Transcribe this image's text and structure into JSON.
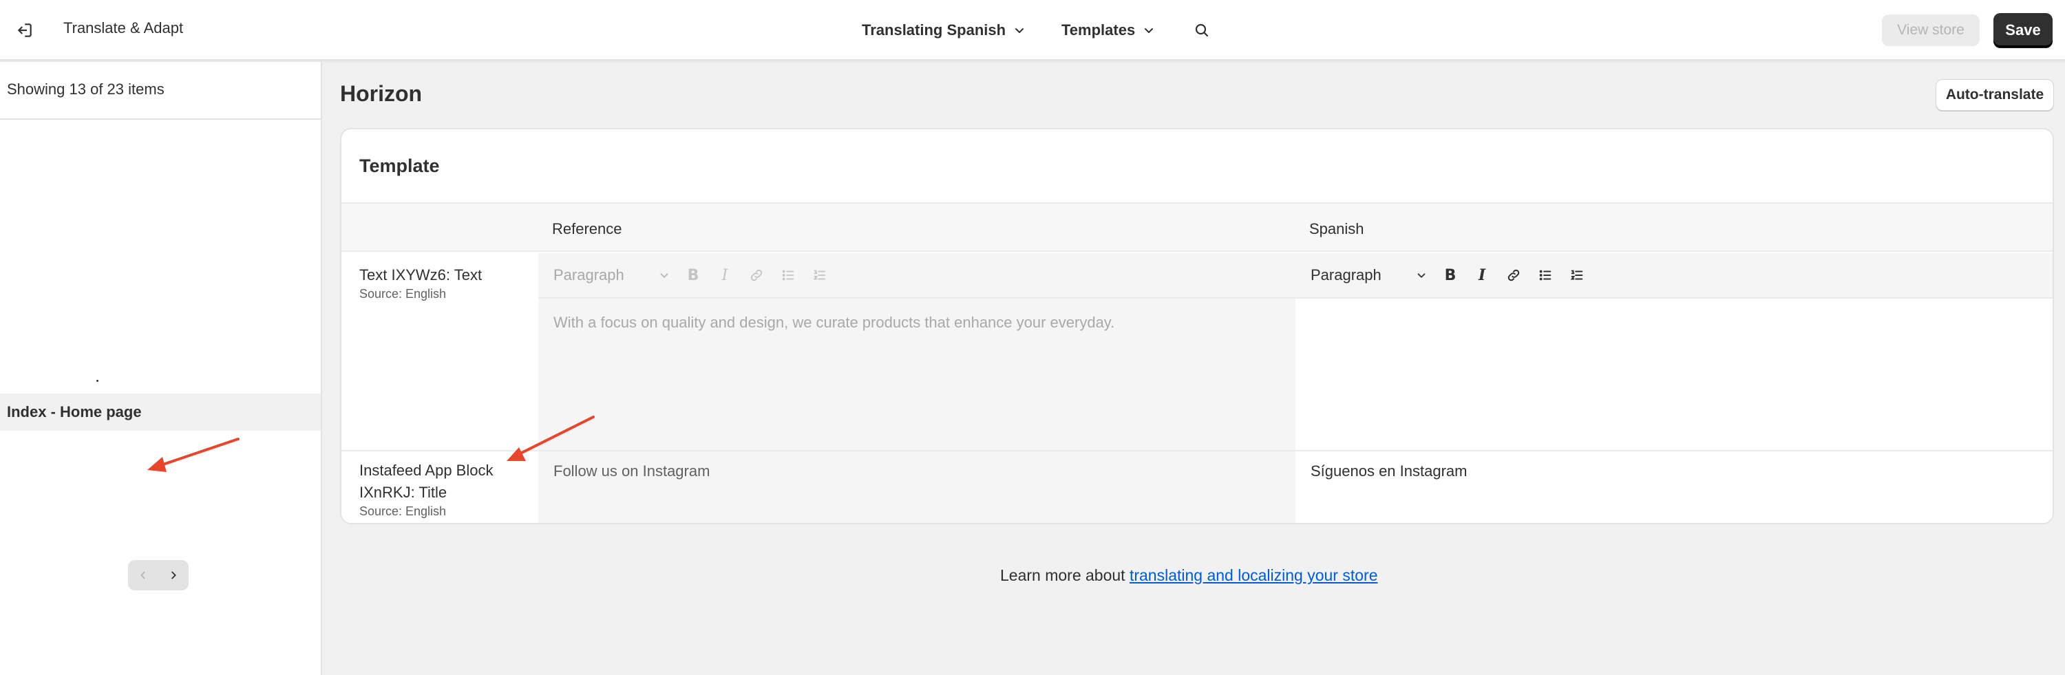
{
  "header": {
    "app_title": "Translate & Adapt",
    "language_dropdown": "Translating Spanish",
    "resource_dropdown": "Templates",
    "view_store_label": "View store",
    "save_label": "Save"
  },
  "sidebar": {
    "count_text": "Showing 13 of 23 items",
    "selected_item": "Index - Home page"
  },
  "main": {
    "theme_title": "Horizon",
    "auto_translate_label": "Auto-translate",
    "section_title": "Template",
    "columns": {
      "reference": "Reference",
      "target": "Spanish"
    },
    "rows": [
      {
        "field": "Text IXYWz6: Text",
        "source": "Source: English",
        "format": "Paragraph",
        "reference": "With a focus on quality and design, we curate products that enhance your everyday.",
        "translation": ""
      },
      {
        "field": "Instafeed App Block IXnRKJ: Title",
        "source": "Source: English",
        "reference": "Follow us on Instagram",
        "translation": "Síguenos en Instagram"
      }
    ]
  },
  "footer": {
    "learn_more_prefix": "Learn more about ",
    "learn_more_link": "translating and localizing your store"
  },
  "colors": {
    "annotation_arrow": "#e8452c",
    "link": "#005bd3",
    "primary_button": "#303030"
  },
  "icons": [
    "exit-icon",
    "chevron-down-icon",
    "search-icon",
    "bold-icon",
    "italic-icon",
    "link-icon",
    "bullet-list-icon",
    "numbered-list-icon",
    "chevron-left-icon",
    "chevron-right-icon"
  ]
}
